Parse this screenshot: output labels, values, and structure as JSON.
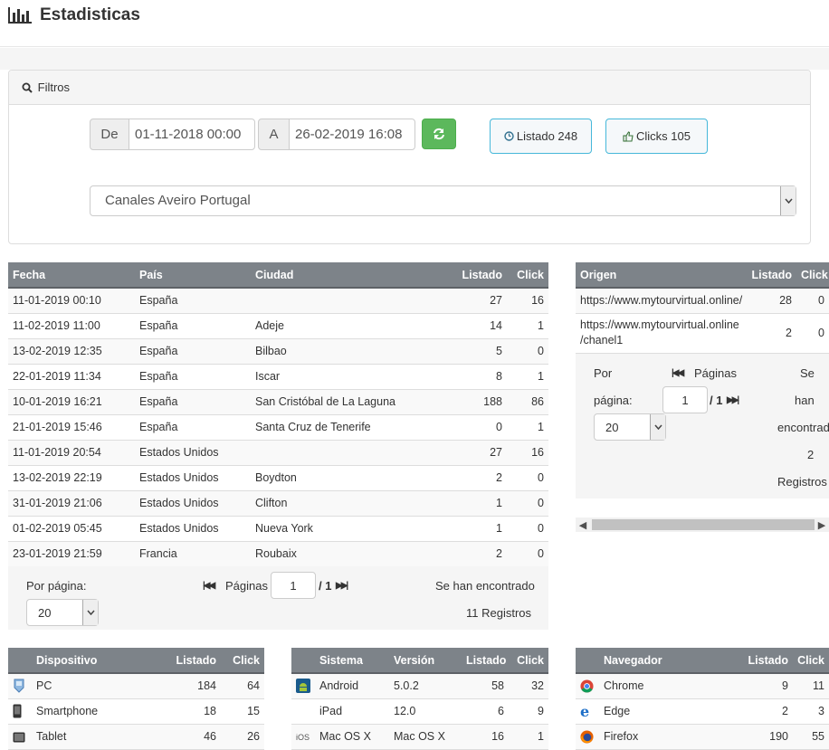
{
  "header": {
    "title": "Estadisticas"
  },
  "filters": {
    "heading": "Filtros",
    "from_label": "De",
    "from_value": "01-11-2018 00:00",
    "to_label": "A",
    "to_value": "26-02-2019 16:08",
    "listado_button": "Listado 248",
    "clicks_button": "Clicks 105",
    "channel_selected": "Canales Aveiro Portugal"
  },
  "main_table": {
    "columns": [
      "Fecha",
      "País",
      "Ciudad",
      "Listado",
      "Click"
    ],
    "rows": [
      [
        "11-01-2019 00:10",
        "España",
        "",
        "27",
        "16"
      ],
      [
        "11-02-2019 11:00",
        "España",
        "Adeje",
        "14",
        "1"
      ],
      [
        "13-02-2019 12:35",
        "España",
        "Bilbao",
        "5",
        "0"
      ],
      [
        "22-01-2019 11:34",
        "España",
        "Iscar",
        "8",
        "1"
      ],
      [
        "10-01-2019 16:21",
        "España",
        "San Cristóbal de La Laguna",
        "188",
        "86"
      ],
      [
        "21-01-2019 15:46",
        "España",
        "Santa Cruz de Tenerife",
        "0",
        "1"
      ],
      [
        "11-01-2019 20:54",
        "Estados Unidos",
        "",
        "27",
        "16"
      ],
      [
        "13-02-2019 22:19",
        "Estados Unidos",
        "Boydton",
        "2",
        "0"
      ],
      [
        "31-01-2019 21:06",
        "Estados Unidos",
        "Clifton",
        "1",
        "0"
      ],
      [
        "01-02-2019 05:45",
        "Estados Unidos",
        "Nueva York",
        "1",
        "0"
      ],
      [
        "23-01-2019 21:59",
        "Francia",
        "Roubaix",
        "2",
        "0"
      ]
    ],
    "pager": {
      "per_page_label": "Por página:",
      "per_page_value": "20",
      "pages_label": "Páginas",
      "page_value": "1",
      "page_total": "/ 1",
      "found_label": "Se han encontrado",
      "records": "11 Registros"
    }
  },
  "origin_table": {
    "columns": [
      "Origen",
      "Listado",
      "Click"
    ],
    "rows": [
      [
        "https://www.mytourvirtual.online/",
        "",
        "28",
        "0"
      ],
      [
        "https://www.mytourvirtual.online",
        "/chanel1",
        "2",
        "0"
      ]
    ],
    "pager": {
      "por": "Por",
      "pagina": "página:",
      "pages_label": "Páginas",
      "page_value": "1",
      "page_total": "/ 1",
      "per_page_value": "20",
      "se": "Se",
      "han": "han",
      "encontrad": "encontrad",
      "count": "2",
      "registros": "Registros"
    }
  },
  "device_table": {
    "columns": [
      "Dispositivo",
      "Listado",
      "Click"
    ],
    "rows": [
      {
        "icon": "pc-icon",
        "name": "PC",
        "listado": "184",
        "click": "64"
      },
      {
        "icon": "smartphone-icon",
        "name": "Smartphone",
        "listado": "18",
        "click": "15"
      },
      {
        "icon": "tablet-icon",
        "name": "Tablet",
        "listado": "46",
        "click": "26"
      }
    ]
  },
  "system_table": {
    "columns": [
      "Sistema",
      "Versión",
      "Listado",
      "Click"
    ],
    "rows": [
      {
        "icon": "android-icon",
        "name": "Android",
        "version": "5.0.2",
        "listado": "58",
        "click": "32"
      },
      {
        "icon": "",
        "name": "iPad",
        "version": "12.0",
        "listado": "6",
        "click": "9"
      },
      {
        "icon": "ios-icon",
        "icon_text": "iOS",
        "name": "Mac OS X",
        "version": "Mac OS X",
        "listado": "16",
        "click": "1"
      }
    ]
  },
  "browser_table": {
    "columns": [
      "Navegador",
      "Listado",
      "Click"
    ],
    "rows": [
      {
        "icon": "chrome-icon",
        "name": "Chrome",
        "listado": "9",
        "click": "11"
      },
      {
        "icon": "edge-icon",
        "name": "Edge",
        "listado": "2",
        "click": "3"
      },
      {
        "icon": "firefox-icon",
        "name": "Firefox",
        "listado": "190",
        "click": "55"
      }
    ]
  },
  "colors": {
    "table_header": "#7d8389",
    "refresh_button": "#5cb85c",
    "info_border": "#46b8da"
  }
}
